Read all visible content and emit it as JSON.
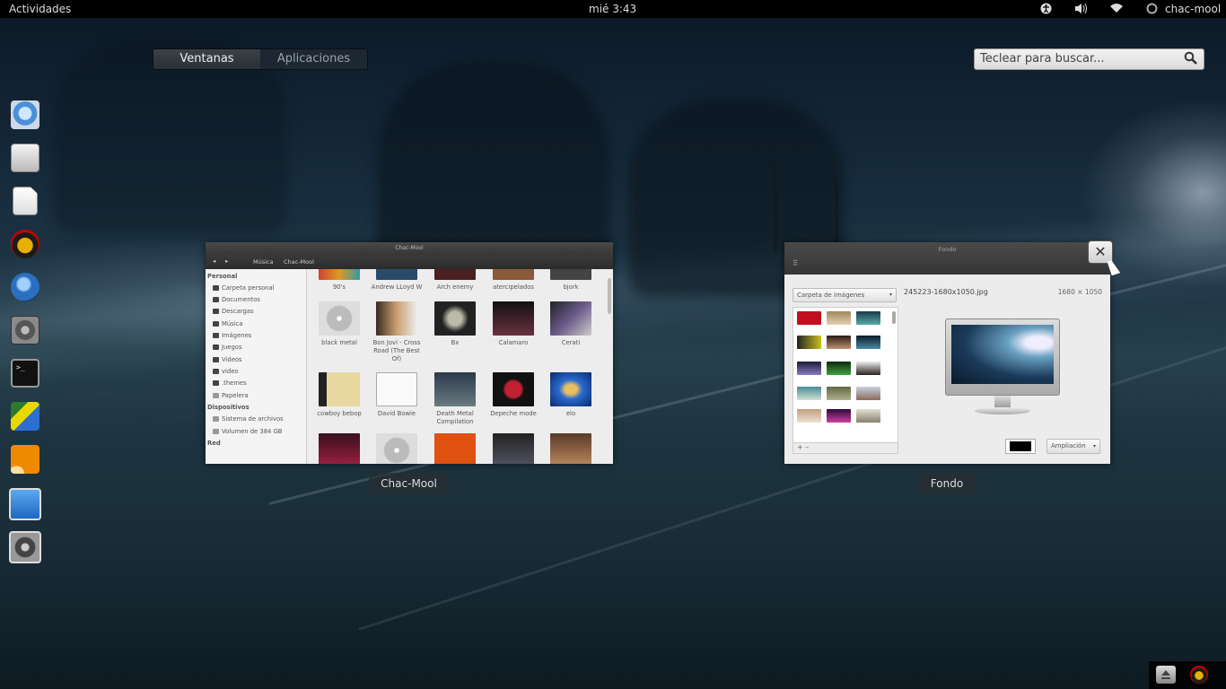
{
  "topbar": {
    "activities": "Actividades",
    "clock": "mié  3:43",
    "user": "chac-mool",
    "icons": [
      "accessibility-icon",
      "volume-icon",
      "wifi-icon",
      "user-status-icon"
    ]
  },
  "overview": {
    "tabs": [
      {
        "label": "Ventanas",
        "active": true
      },
      {
        "label": "Aplicaciones",
        "active": false
      }
    ],
    "search_placeholder": "Teclear para buscar..."
  },
  "dash": {
    "items": [
      "chromium-icon",
      "file-manager-icon",
      "text-editor-icon",
      "vlc-icon",
      "thunderbird-icon",
      "system-settings-icon",
      "terminal-icon",
      "inkscape-icon",
      "orange-app-icon",
      "mail-app-icon",
      "settings-app-icon"
    ]
  },
  "windows": {
    "chacmool": {
      "title": "Chac-Mool",
      "label": "Chac-Mool",
      "path": [
        "Música",
        "Chac-Mool"
      ],
      "sidebar": {
        "personal_header": "Personal",
        "personal": [
          "Carpeta personal",
          "Documentos",
          "Descargas",
          "Música",
          "Imágenes",
          "Juegos",
          "Videos",
          "video",
          ".themes",
          "Papelera"
        ],
        "devices_header": "Dispositivos",
        "devices": [
          "Sistema de archivos",
          "Volumen de 384 GB"
        ],
        "network_header": "Red"
      },
      "top_row": [
        "90's",
        "Andrew LLoyd W",
        "Arch enemy",
        "atercipelados",
        "bjork"
      ],
      "rows": [
        [
          "black metal",
          "Bon Jovi - Cross Road (The Best Of)",
          "Bx",
          "Calamaro",
          "Cerati"
        ],
        [
          "cowboy bebop",
          "David Bowie",
          "Death Metal Compilation",
          "Depeche mode",
          "elo"
        ]
      ]
    },
    "fondo": {
      "title": "Fondo",
      "label": "Fondo",
      "folder": "Carpeta de imágenes",
      "filename": "245223-1680x1050.jpg",
      "resolution": "1680 × 1050",
      "mode": "Ampliación"
    }
  },
  "colors": {
    "accent": "#2a3034",
    "topbar": "#000000"
  }
}
